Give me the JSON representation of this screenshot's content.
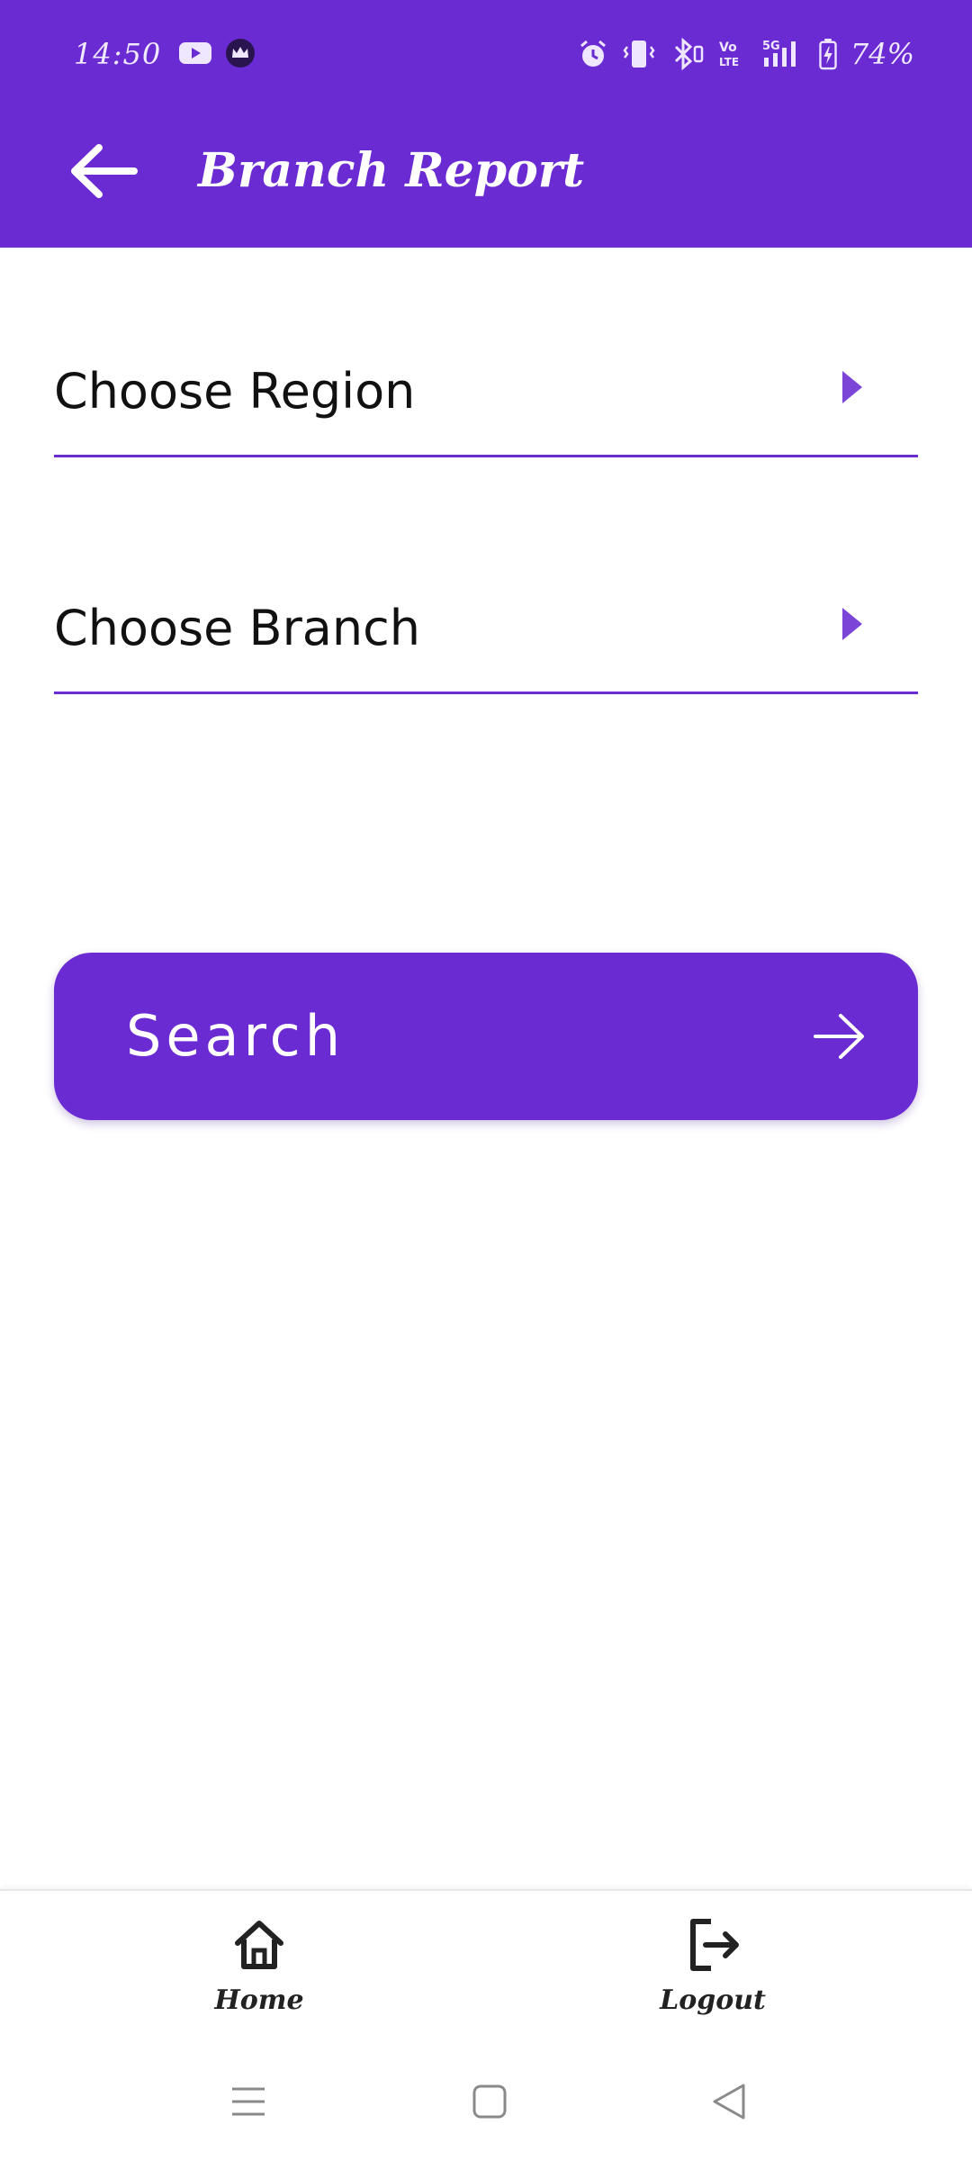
{
  "status_bar": {
    "time": "14:50",
    "battery": "74%",
    "left_icons": [
      "youtube-icon",
      "crown-app-icon"
    ],
    "right_icons": [
      "alarm-icon",
      "vibrate-icon",
      "bluetooth-icon",
      "volte-icon",
      "5g-signal-icon",
      "battery-charging-icon"
    ]
  },
  "app_bar": {
    "title": "Branch Report",
    "back_icon": "arrow-left-icon",
    "color": "#6a2bd3"
  },
  "form": {
    "region": {
      "label": "Choose Region",
      "icon": "caret-right-icon"
    },
    "branch": {
      "label": "Choose Branch",
      "icon": "caret-right-icon"
    }
  },
  "search_button": {
    "label": "Search",
    "icon": "arrow-right-icon"
  },
  "bottom_nav": {
    "items": [
      {
        "label": "Home",
        "icon": "home-icon"
      },
      {
        "label": "Logout",
        "icon": "logout-icon"
      }
    ]
  },
  "system_nav": {
    "items": [
      "menu-icon",
      "home-square-icon",
      "back-triangle-icon"
    ]
  }
}
